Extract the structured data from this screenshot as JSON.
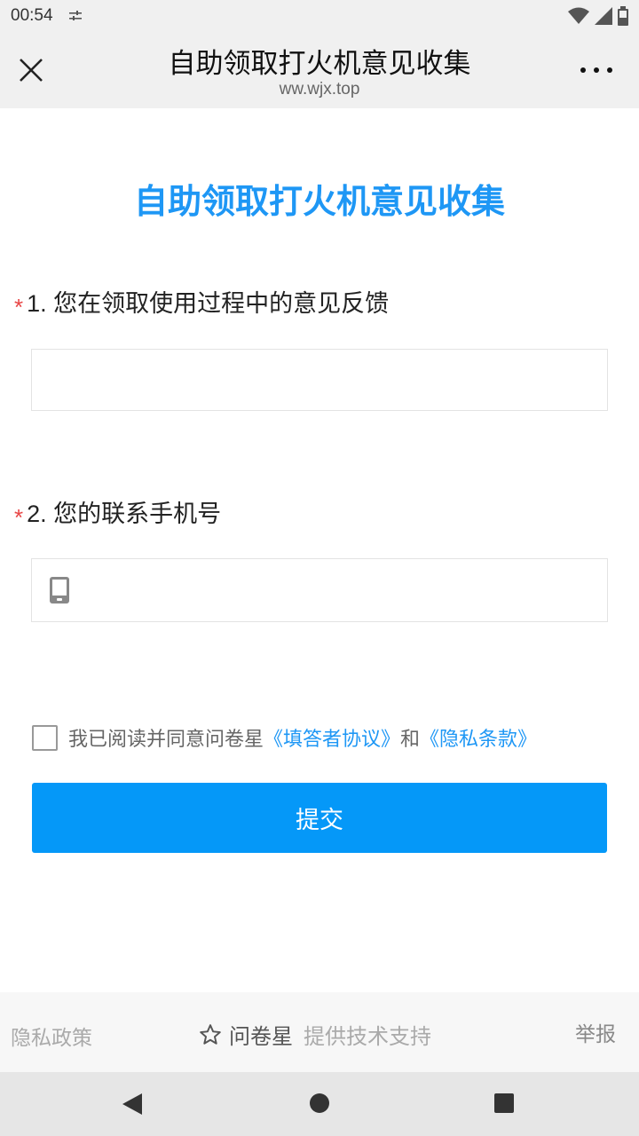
{
  "status_bar": {
    "time": "00:54",
    "icons": [
      "settings-sliders-icon",
      "wifi-icon",
      "signal-icon",
      "battery-icon"
    ]
  },
  "browser": {
    "title": "自助领取打火机意见收集",
    "url": "ww.wjx.top",
    "close_icon": "close-icon",
    "more_icon": "more-icon"
  },
  "survey": {
    "title": "自助领取打火机意见收集",
    "questions": [
      {
        "required_mark": "*",
        "label": "1. 您在领取使用过程中的意见反馈",
        "value": "",
        "placeholder": ""
      },
      {
        "required_mark": "*",
        "label": "2. 您的联系手机号",
        "value": "",
        "placeholder": ""
      }
    ],
    "agreement": {
      "text": "我已阅读并同意问卷星",
      "link1": "《填答者协议》",
      "conjunction": "和",
      "link2": "《隐私条款》",
      "checked": false
    },
    "submit_label": "提交"
  },
  "footer": {
    "privacy": "隐私政策",
    "brand_name": "问卷星",
    "brand_tag": "提供技术支持",
    "report": "举报"
  },
  "colors": {
    "accent": "#1e97f5",
    "button": "#0598f8",
    "required": "#e84646"
  }
}
